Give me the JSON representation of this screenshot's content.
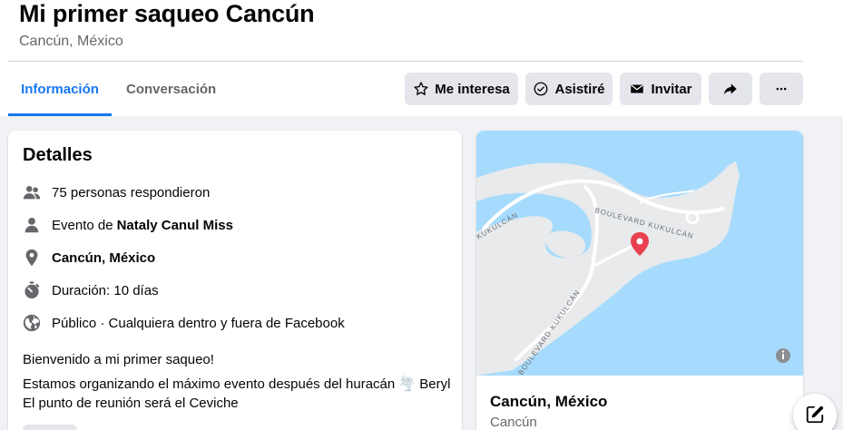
{
  "event": {
    "title": "Mi primer saqueo Cancún",
    "location": "Cancún, México"
  },
  "tabs": [
    {
      "label": "Información",
      "active": true
    },
    {
      "label": "Conversación",
      "active": false
    }
  ],
  "actions": {
    "interesa": "Me interesa",
    "asistire": "Asistiré",
    "invitar": "Invitar"
  },
  "details": {
    "title": "Detalles",
    "responded": "75 personas respondieron",
    "host_prefix": "Evento de ",
    "host_name": "Nataly Canul Miss",
    "place": "Cancún, México",
    "duration": "Duración: 10 días",
    "privacy": "Público · Cualquiera dentro y fuera de Facebook",
    "description": [
      "Bienvenido a mi primer saqueo!",
      "Estamos organizando el máximo evento después del huracán 🌪️ Beryl",
      "El punto de reunión será el Ceviche"
    ]
  },
  "map": {
    "place": "Cancún, México",
    "city": "Cancún",
    "road_labels": [
      "BOULEVARD KUKULCÁN",
      "BOULEVARD KUKULCÁN",
      "KUKULCÁN"
    ]
  },
  "colors": {
    "accent": "#1877f2",
    "water": "#a6dbfd",
    "land": "#e8eaec",
    "pin": "#e8404f"
  },
  "icons": [
    "star-icon",
    "check-circle-icon",
    "envelope-icon",
    "share-icon",
    "more-icon",
    "people-icon",
    "person-icon",
    "location-pin-icon",
    "stopwatch-icon",
    "globe-icon",
    "info-icon",
    "compose-icon"
  ]
}
